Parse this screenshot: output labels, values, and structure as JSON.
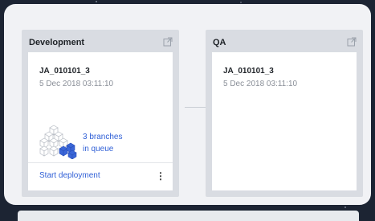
{
  "stages": [
    {
      "name": "Development",
      "build_id": "JA_010101_3",
      "date": "5 Dec 2018 03:11:10",
      "queue_line1": "3 branches",
      "queue_line2": "in queue",
      "deploy_label": "Start deployment",
      "more_glyph": "⋮"
    },
    {
      "name": "QA",
      "build_id": "JA_010101_3",
      "date": "5 Dec 2018 03:11:10"
    }
  ],
  "colors": {
    "link": "#2f5fd6",
    "cube_highlight": "#3a66d8"
  },
  "icons": {
    "external_link": "external-link-icon",
    "cubes": "cubes-icon",
    "more": "more-vertical-icon"
  }
}
